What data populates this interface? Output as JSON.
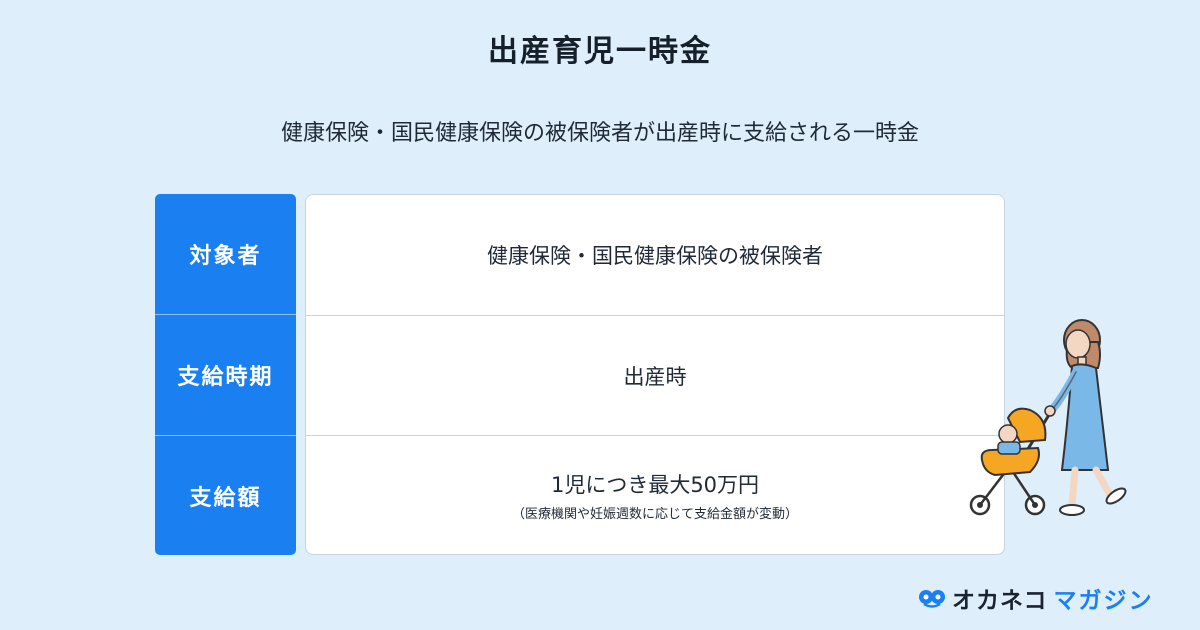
{
  "title": "出産育児一時金",
  "subtitle": "健康保険・国民健康保険の被保険者が出産時に支給される一時金",
  "rows": [
    {
      "label": "対象者",
      "value": "健康保険・国民健康保険の被保険者",
      "note": ""
    },
    {
      "label": "支給時期",
      "value": "出産時",
      "note": ""
    },
    {
      "label": "支給額",
      "value": "1児につき最大50万円",
      "note": "（医療機関や妊娠週数に応じて支給金額が変動）"
    }
  ],
  "brand": {
    "main": "オカネコ",
    "sub": "マガジン",
    "icon": "okaneko-logo-icon"
  },
  "colors": {
    "background": "#dfeefb",
    "accent": "#1a7ff1",
    "stroller": "#f5a623"
  }
}
